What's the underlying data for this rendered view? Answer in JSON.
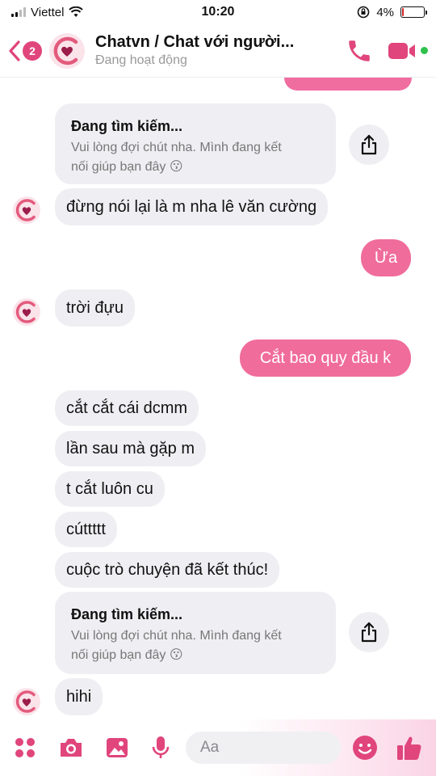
{
  "status": {
    "carrier": "Viettel",
    "time": "10:20",
    "battery": "4%",
    "battery_level": 0.04,
    "battery_color": "#d22222"
  },
  "header": {
    "badge_count": "2",
    "title": "Chatvn / Chat với người...",
    "subtitle": "Đang hoạt động",
    "accent": "#e0457b",
    "icons": [
      "back-chevron-icon",
      "phone-icon",
      "video-call-icon"
    ]
  },
  "colors": {
    "outgoing_bubble": "#f06c9b",
    "incoming_bubble": "#efeff3"
  },
  "messages": [
    {
      "type": "card",
      "title": "Đang tìm kiếm...",
      "body_line1": "Vui lòng đợi chút nha. Mình đang kết",
      "body_line2": "nối giúp bạn đây 😗"
    },
    {
      "type": "in",
      "text": "đừng nói lại là m nha lê văn cường"
    },
    {
      "type": "out",
      "text": "Ừa"
    },
    {
      "type": "in",
      "text": "trời đựu"
    },
    {
      "type": "out",
      "text": "Cắt bao quy đầu k"
    },
    {
      "type": "in",
      "text": "cắt cắt cái dcmm"
    },
    {
      "type": "in",
      "text": "lần sau mà gặp m"
    },
    {
      "type": "in",
      "text": "t cắt luôn cu"
    },
    {
      "type": "in",
      "text": "cúttttt"
    },
    {
      "type": "in",
      "text": "cuộc trò chuyện đã kết thúc!"
    },
    {
      "type": "card",
      "title": "Đang tìm kiếm...",
      "body_line1": "Vui lòng đợi chút nha. Mình đang kết",
      "body_line2": "nối giúp bạn đây 😗"
    },
    {
      "type": "in",
      "text": "hihi"
    }
  ],
  "composer": {
    "placeholder": "Aa",
    "icons": [
      "apps-grid-icon",
      "camera-icon",
      "image-icon",
      "microphone-icon",
      "emoji-icon",
      "thumbs-up-icon"
    ]
  }
}
